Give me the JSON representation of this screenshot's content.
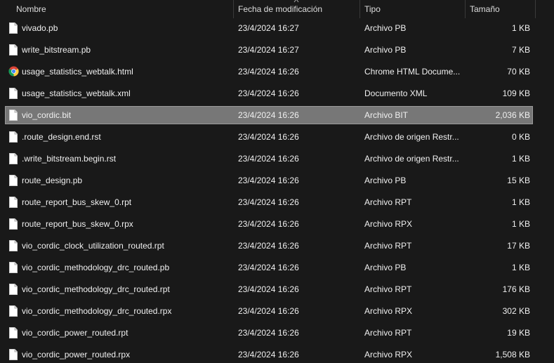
{
  "columns": {
    "name": "Nombre",
    "date": "Fecha de modificación",
    "type": "Tipo",
    "size": "Tamaño"
  },
  "files": [
    {
      "name": "vivado.pb",
      "date": "23/4/2024 16:27",
      "type": "Archivo PB",
      "size": "1 KB",
      "icon": "file-icon"
    },
    {
      "name": "write_bitstream.pb",
      "date": "23/4/2024 16:27",
      "type": "Archivo PB",
      "size": "7 KB",
      "icon": "file-icon"
    },
    {
      "name": "usage_statistics_webtalk.html",
      "date": "23/4/2024 16:26",
      "type": "Chrome HTML Docume...",
      "size": "70 KB",
      "icon": "chrome-icon"
    },
    {
      "name": "usage_statistics_webtalk.xml",
      "date": "23/4/2024 16:26",
      "type": "Documento XML",
      "size": "109 KB",
      "icon": "file-icon"
    },
    {
      "name": "vio_cordic.bit",
      "date": "23/4/2024 16:26",
      "type": "Archivo BIT",
      "size": "2,036 KB",
      "icon": "file-icon",
      "selected": true
    },
    {
      "name": ".route_design.end.rst",
      "date": "23/4/2024 16:26",
      "type": "Archivo de origen Restr...",
      "size": "0 KB",
      "icon": "file-icon"
    },
    {
      "name": ".write_bitstream.begin.rst",
      "date": "23/4/2024 16:26",
      "type": "Archivo de origen Restr...",
      "size": "1 KB",
      "icon": "file-icon"
    },
    {
      "name": "route_design.pb",
      "date": "23/4/2024 16:26",
      "type": "Archivo PB",
      "size": "15 KB",
      "icon": "file-icon"
    },
    {
      "name": "route_report_bus_skew_0.rpt",
      "date": "23/4/2024 16:26",
      "type": "Archivo RPT",
      "size": "1 KB",
      "icon": "file-icon"
    },
    {
      "name": "route_report_bus_skew_0.rpx",
      "date": "23/4/2024 16:26",
      "type": "Archivo RPX",
      "size": "1 KB",
      "icon": "file-icon"
    },
    {
      "name": "vio_cordic_clock_utilization_routed.rpt",
      "date": "23/4/2024 16:26",
      "type": "Archivo RPT",
      "size": "17 KB",
      "icon": "file-icon"
    },
    {
      "name": "vio_cordic_methodology_drc_routed.pb",
      "date": "23/4/2024 16:26",
      "type": "Archivo PB",
      "size": "1 KB",
      "icon": "file-icon"
    },
    {
      "name": "vio_cordic_methodology_drc_routed.rpt",
      "date": "23/4/2024 16:26",
      "type": "Archivo RPT",
      "size": "176 KB",
      "icon": "file-icon"
    },
    {
      "name": "vio_cordic_methodology_drc_routed.rpx",
      "date": "23/4/2024 16:26",
      "type": "Archivo RPX",
      "size": "302 KB",
      "icon": "file-icon"
    },
    {
      "name": "vio_cordic_power_routed.rpt",
      "date": "23/4/2024 16:26",
      "type": "Archivo RPT",
      "size": "19 KB",
      "icon": "file-icon"
    },
    {
      "name": "vio_cordic_power_routed.rpx",
      "date": "23/4/2024 16:26",
      "type": "Archivo RPX",
      "size": "1,508 KB",
      "icon": "file-icon"
    }
  ],
  "colors": {
    "background": "#191919",
    "selected_row": "#777777",
    "text": "#f0f0f0"
  }
}
